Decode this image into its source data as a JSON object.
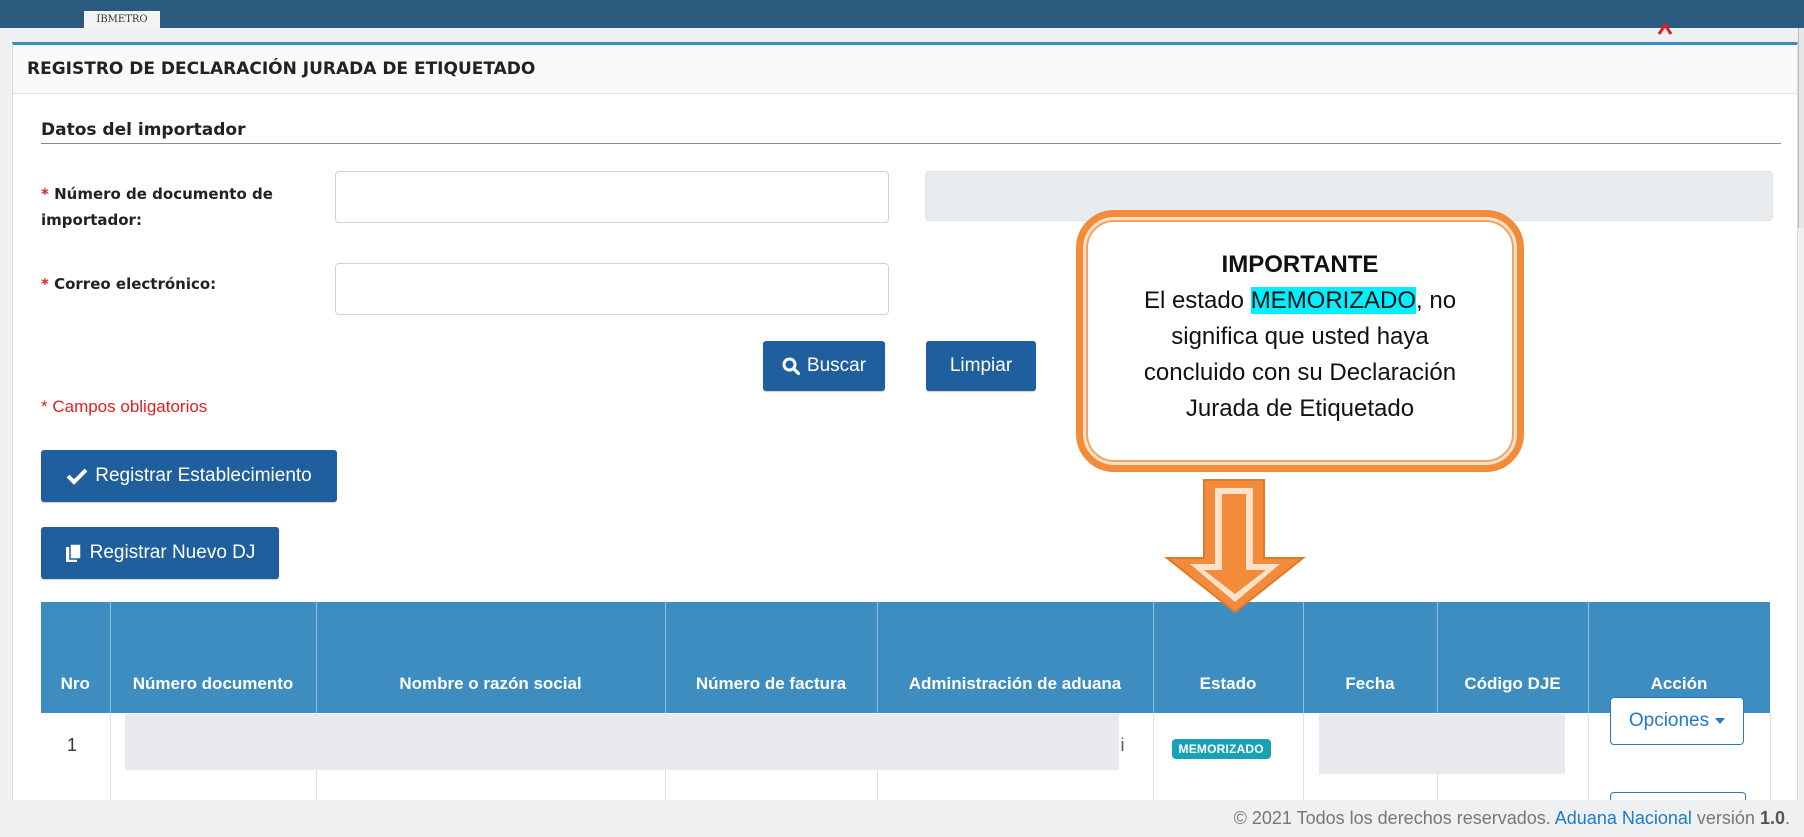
{
  "header": {
    "logo_text": "IBMETRO"
  },
  "panel": {
    "title": "REGISTRO DE DECLARACIÓN JURADA DE ETIQUETADO"
  },
  "form": {
    "section_title": "Datos del importador",
    "required_mark": "*",
    "doc_label": "Número de documento de importador:",
    "email_label": "Correo electrónico:",
    "doc_value": "",
    "email_value": "",
    "search_button": "Buscar",
    "clear_button": "Limpiar",
    "required_note": "* Campos obligatorios"
  },
  "actions": {
    "register_establishment": "Registrar Establecimiento",
    "register_new_dj": "Registrar Nuevo DJ"
  },
  "callout": {
    "title": "IMPORTANTE",
    "line1_prefix": "El estado ",
    "line1_highlight": "MEMORIZADO",
    "line1_suffix": ", no",
    "line2": "significa que usted haya",
    "line3": "concluido con su Declaración",
    "line4": "Jurada de Etiquetado",
    "border_color": "#f28c3a",
    "highlight_color": "#00f0ff"
  },
  "table": {
    "columns": [
      "Nro",
      "Número documento",
      "Nombre o razón social",
      "Número de factura",
      "Administración de aduana",
      "Estado",
      "Fecha",
      "Código DJE",
      "Acción"
    ],
    "rows": [
      {
        "nro": "1",
        "trailing_char": "i",
        "estado": "MEMORIZADO",
        "accion": "Opciones"
      }
    ],
    "header_color": "#3d8dc0",
    "badge_color": "#17a2b8"
  },
  "footer": {
    "prefix": "© 2021 Todos los derechos reservados.",
    "link": "Aduana Nacional",
    "version_label": "versión",
    "version": "1.0",
    "suffix": "."
  }
}
